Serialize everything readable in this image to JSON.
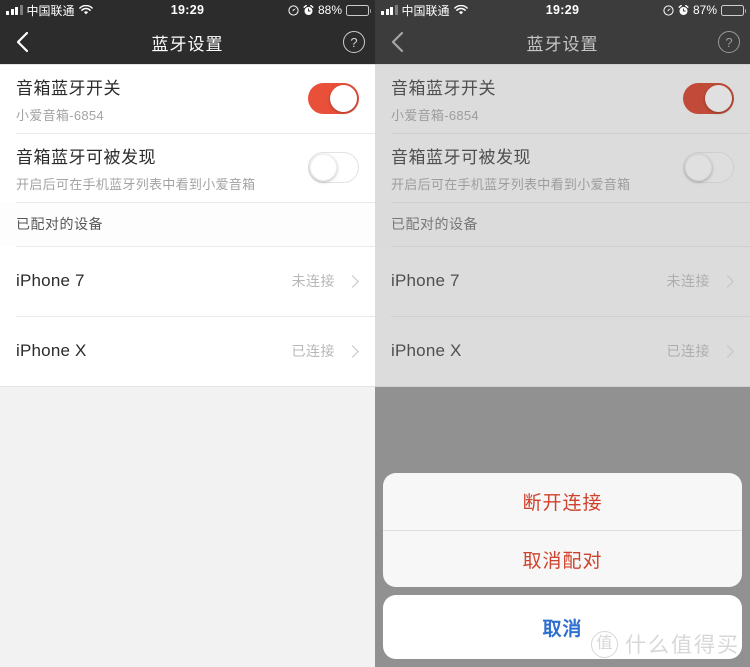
{
  "screens": [
    {
      "id": "left",
      "dimmed": false,
      "status_bar": {
        "carrier": "中国联通",
        "signal_icon": "signal-bars-icon",
        "wifi_icon": "wifi-icon",
        "time": "19:29",
        "location_icon": "location-arrow-icon",
        "alarm_icon": "alarm-clock-icon",
        "battery_percent": "88%",
        "battery_icon": "battery-icon"
      },
      "nav": {
        "back_icon": "chevron-left-icon",
        "title": "蓝牙设置",
        "help_icon": "question-mark-circle-icon",
        "help_label": "?"
      },
      "settings": [
        {
          "title": "音箱蓝牙开关",
          "subtitle": "小爱音箱-6854",
          "toggle": "on"
        },
        {
          "title": "音箱蓝牙可被发现",
          "subtitle": "开启后可在手机蓝牙列表中看到小爱音箱",
          "toggle": "off"
        }
      ],
      "section_header": "已配对的设备",
      "devices": [
        {
          "name": "iPhone 7",
          "status": "未连接",
          "chevron_icon": "chevron-right-icon"
        },
        {
          "name": "iPhone X",
          "status": "已连接",
          "chevron_icon": "chevron-right-icon"
        }
      ],
      "action_sheet": null
    },
    {
      "id": "right",
      "dimmed": true,
      "status_bar": {
        "carrier": "中国联通",
        "signal_icon": "signal-bars-icon",
        "wifi_icon": "wifi-icon",
        "time": "19:29",
        "location_icon": "location-arrow-icon",
        "alarm_icon": "alarm-clock-icon",
        "battery_percent": "87%",
        "battery_icon": "battery-icon"
      },
      "nav": {
        "back_icon": "chevron-left-icon",
        "title": "蓝牙设置",
        "help_icon": "question-mark-circle-icon",
        "help_label": "?"
      },
      "settings": [
        {
          "title": "音箱蓝牙开关",
          "subtitle": "小爱音箱-6854",
          "toggle": "on"
        },
        {
          "title": "音箱蓝牙可被发现",
          "subtitle": "开启后可在手机蓝牙列表中看到小爱音箱",
          "toggle": "off"
        }
      ],
      "section_header": "已配对的设备",
      "devices": [
        {
          "name": "iPhone 7",
          "status": "未连接",
          "chevron_icon": "chevron-right-icon"
        },
        {
          "name": "iPhone X",
          "status": "已连接",
          "chevron_icon": "chevron-right-icon"
        }
      ],
      "action_sheet": {
        "options": [
          {
            "label": "断开连接",
            "style": "destructive"
          },
          {
            "label": "取消配对",
            "style": "destructive"
          }
        ],
        "cancel_label": "取消"
      },
      "watermark": {
        "logo_char": "值",
        "text": "什么值得买"
      }
    }
  ],
  "colors": {
    "toggle_on": "#e8503a",
    "nav_bar": "#2c2c2c",
    "destructive": "#d0422c",
    "cancel_blue": "#2f6fd0",
    "page_bg": "#f2f2f2",
    "dim_overlay": "#919191"
  }
}
